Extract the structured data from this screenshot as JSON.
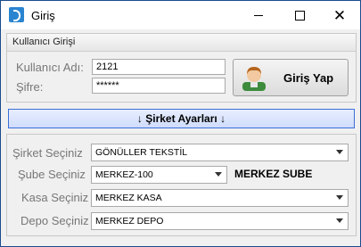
{
  "window": {
    "title": "Giriş",
    "minimize_icon": "minimize-icon",
    "maximize_icon": "maximize-icon",
    "close_icon": "close-icon"
  },
  "login_group": {
    "title": "Kullanıcı Girişi",
    "username_label": "Kullanıcı Adı:",
    "username_value": "2121",
    "password_label": "Şifre:",
    "password_value": "******",
    "login_button_label": "Giriş Yap",
    "login_button_icon": "user-avatar-icon"
  },
  "company_settings_toggle": {
    "label": "↓ Şirket Ayarları ↓"
  },
  "company_group": {
    "company_label": "Şirket Seçiniz",
    "company_value": "GÖNÜLLER TEKSTİL",
    "branch_label": "Şube Seçiniz",
    "branch_value": "MERKEZ-100",
    "branch_note": "MERKEZ SUBE",
    "cashbox_label": "Kasa Seçiniz",
    "cashbox_value": "MERKEZ KASA",
    "warehouse_label": "Depo Seçiniz",
    "warehouse_value": "MERKEZ DEPO"
  },
  "colors": {
    "accent_blue": "#3a6fd8",
    "window_border": "#1a4c8f",
    "background": "#f0f0f0"
  }
}
